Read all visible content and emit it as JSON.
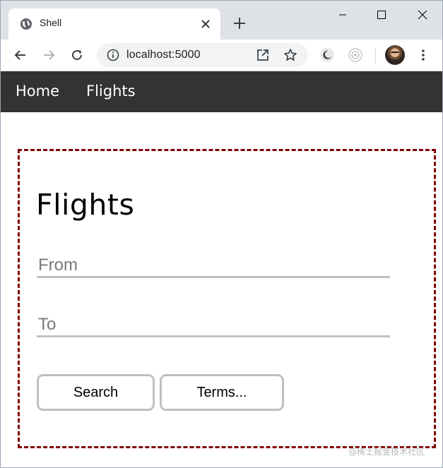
{
  "browser": {
    "tab_title": "Shell",
    "url": "localhost:5000"
  },
  "nav": {
    "items": [
      {
        "label": "Home"
      },
      {
        "label": "Flights"
      }
    ]
  },
  "flights": {
    "title": "Flights",
    "from_placeholder": "From",
    "from_value": "",
    "to_placeholder": "To",
    "to_value": "",
    "search_label": "Search",
    "terms_label": "Terms..."
  },
  "watermark": "@稀土掘金技术社区",
  "colors": {
    "nav_background": "#333333",
    "card_border": "#800000",
    "field_underline": "#c0c0c0"
  },
  "icons": [
    "globe-icon",
    "close-icon",
    "plus-icon",
    "minimize-icon",
    "maximize-icon",
    "window-close-icon",
    "back-arrow-icon",
    "forward-arrow-icon",
    "reload-icon",
    "info-icon",
    "open-in-app-icon",
    "star-icon",
    "moon-extension-icon",
    "record-extension-icon",
    "kebab-menu-icon"
  ]
}
